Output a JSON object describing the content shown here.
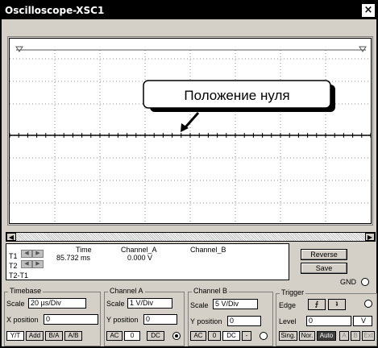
{
  "window": {
    "title": "Oscilloscope-XSC1",
    "close": "×"
  },
  "screen": {
    "callout": "Положение нуля"
  },
  "readout": {
    "t1": "T1",
    "t2": "T2",
    "t2t1": "T2-T1",
    "time_header": "Time",
    "cha_header": "Channel_A",
    "chb_header": "Channel_B",
    "time_value": "85.732 ms",
    "cha_value": "0.000 V",
    "chb_value": ""
  },
  "buttons": {
    "reverse": "Reverse",
    "save": "Save",
    "gnd": "GND"
  },
  "timebase": {
    "title": "Timebase",
    "scale_label": "Scale",
    "scale_value": "20 µs/Div",
    "xpos_label": "X position",
    "xpos_value": "0",
    "modes": [
      "Y/T",
      "Add",
      "B/A",
      "A/B"
    ]
  },
  "channel_a": {
    "title": "Channel A",
    "scale_label": "Scale",
    "scale_value": "1  V/Div",
    "ypos_label": "Y position",
    "ypos_value": "0",
    "coupling": [
      "AC",
      "0",
      "DC"
    ]
  },
  "channel_b": {
    "title": "Channel B",
    "scale_label": "Scale",
    "scale_value": "5  V/Div",
    "ypos_label": "Y position",
    "ypos_value": "0",
    "coupling": [
      "AC",
      "0",
      "DC",
      "-"
    ]
  },
  "trigger": {
    "title": "Trigger",
    "edge_label": "Edge",
    "level_label": "Level",
    "level_value": "0",
    "level_unit": "V",
    "rising": "⨍",
    "falling": "ʇ",
    "modes": [
      "Sing.",
      "Nor.",
      "Auto"
    ],
    "sources": [
      "A",
      "B",
      "Ext"
    ]
  }
}
